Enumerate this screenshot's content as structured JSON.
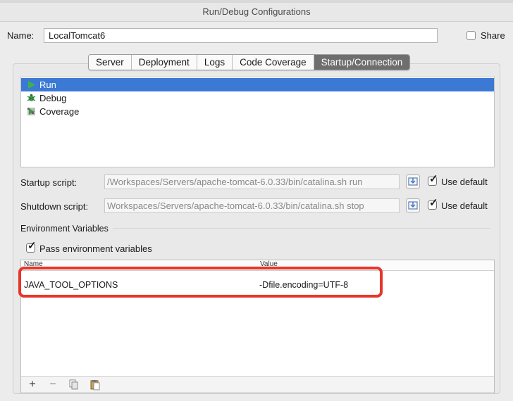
{
  "window": {
    "title": "Run/Debug Configurations"
  },
  "name": {
    "label": "Name:",
    "value": "LocalTomcat6"
  },
  "share": {
    "label": "Share",
    "checked": false
  },
  "tabs": [
    {
      "label": "Server",
      "active": false
    },
    {
      "label": "Deployment",
      "active": false
    },
    {
      "label": "Logs",
      "active": false
    },
    {
      "label": "Code Coverage",
      "active": false
    },
    {
      "label": "Startup/Connection",
      "active": true
    }
  ],
  "modes": [
    {
      "label": "Run",
      "icon": "run-icon",
      "selected": true
    },
    {
      "label": "Debug",
      "icon": "debug-icon",
      "selected": false
    },
    {
      "label": "Coverage",
      "icon": "coverage-icon",
      "selected": false
    }
  ],
  "startup": {
    "label": "Startup script:",
    "value": "/Workspaces/Servers/apache-tomcat-6.0.33/bin/catalina.sh run",
    "use_default_label": "Use default",
    "use_default_checked": true
  },
  "shutdown": {
    "label": "Shutdown script:",
    "value": "Workspaces/Servers/apache-tomcat-6.0.33/bin/catalina.sh stop",
    "use_default_label": "Use default",
    "use_default_checked": true
  },
  "env": {
    "section_label": "Environment Variables",
    "pass_label": "Pass environment variables",
    "pass_checked": true,
    "columns": [
      "Name",
      "Value"
    ],
    "rows": [
      {
        "name": "JAVA_TOOL_OPTIONS",
        "value": "-Dfile.encoding=UTF-8"
      }
    ],
    "toolbar": [
      "+",
      "−",
      "copy-icon",
      "paste-icon"
    ]
  },
  "colors": {
    "selection": "#3b79d4",
    "highlight": "#e8352a",
    "active_tab": "#6e6e6e"
  }
}
